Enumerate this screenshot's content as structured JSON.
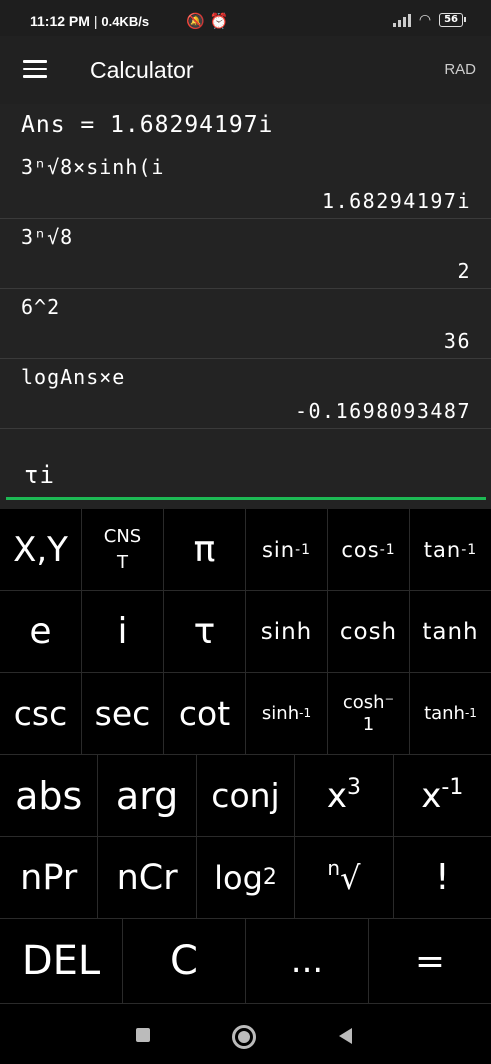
{
  "status_bar": {
    "time": "11:12 PM",
    "separator": "|",
    "net_rate": "0.4KB/s",
    "icons": "🔕 ⏰",
    "battery": "56"
  },
  "app_bar": {
    "title": "Calculator",
    "angle_mode": "RAD"
  },
  "display": {
    "ans_line": "Ans = 1.68294197i",
    "history": [
      {
        "expr": "3ⁿ√8×sinh(i",
        "result": "1.68294197i"
      },
      {
        "expr": "3ⁿ√8",
        "result": "2"
      },
      {
        "expr": "6^2",
        "result": "36"
      },
      {
        "expr": "logAns×e",
        "result": "-0.1698093487"
      }
    ],
    "current_input": "τi"
  },
  "keypad": {
    "row1": [
      "X,Y",
      "CNST",
      "π",
      "sin",
      "cos",
      "tan"
    ],
    "row1_sup": "-1",
    "row1_cnst": [
      "CNS",
      "T"
    ],
    "row2": [
      "e",
      "i",
      "τ",
      "sinh",
      "cosh",
      "tanh"
    ],
    "row3": [
      "csc",
      "sec",
      "cot",
      "sinh",
      "cosh",
      "tanh"
    ],
    "row3_sup": "-1",
    "row3_cosh_inv": [
      "cosh⁻",
      "1"
    ],
    "row4": [
      "abs",
      "arg",
      "conj",
      "x",
      "x"
    ],
    "row4_sup": [
      "3",
      "-1"
    ],
    "row5": [
      "nPr",
      "nCr",
      "log",
      "√",
      "!"
    ],
    "row5_sub": "2",
    "row5_sup": "n",
    "row6": [
      "DEL",
      "C",
      "...",
      "="
    ]
  }
}
